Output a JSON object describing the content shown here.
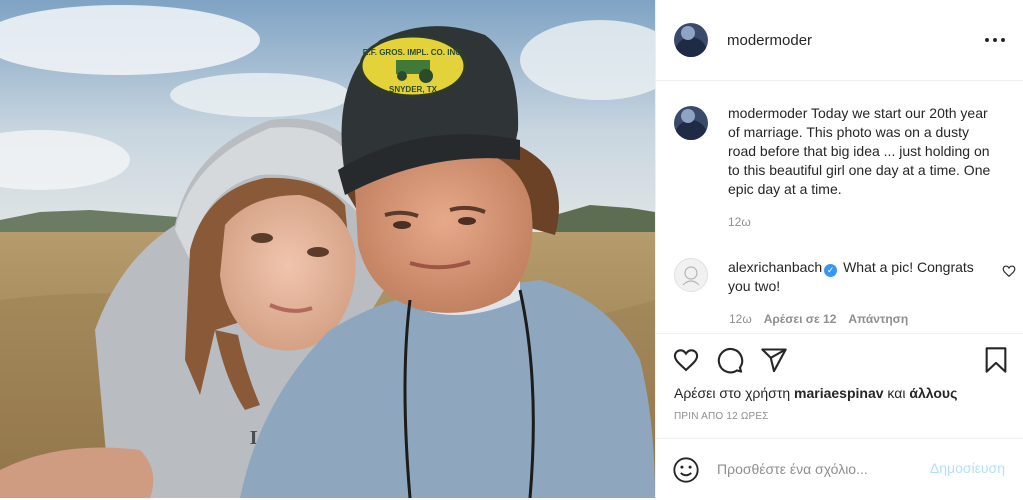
{
  "post": {
    "username": "modermoder",
    "caption_text": "Today we start our 20th year of marriage. This photo was on a dusty road before that big idea ... just holding on to this beautiful girl one day at a time. One epic day at a time.",
    "caption_time": "12ω",
    "photo_text": {
      "cap_patch_line1": "R.F. GROS. IMPL. CO. INC.",
      "cap_patch_line2": "SNYDER, TX",
      "hoodie_text": "LUCK"
    }
  },
  "comment": {
    "username": "alexrichanbach",
    "text": "What a pic! Congrats you two!",
    "time": "12ω",
    "likes_label": "Αρέσει σε 12",
    "reply_label": "Απάντηση"
  },
  "likes": {
    "prefix": "Αρέσει στο χρήστη",
    "user": "mariaespinav",
    "connector": "και",
    "others": "άλλους"
  },
  "timestamp": "ΠΡΙΝ ΑΠΟ 12 ΩΡΕΣ",
  "add_comment": {
    "placeholder": "Προσθέστε ένα σχόλιο...",
    "publish_label": "Δημοσίευση"
  },
  "icons": {
    "more": "more-options-icon",
    "heart": "heart-icon",
    "comment": "comment-icon",
    "share": "share-icon",
    "save": "bookmark-icon",
    "emoji": "emoji-icon",
    "verified": "verified-badge-icon"
  },
  "colors": {
    "link_blue_disabled": "#b2dffc",
    "verified_blue": "#3897f0",
    "secondary_text": "#8e8e8e"
  }
}
